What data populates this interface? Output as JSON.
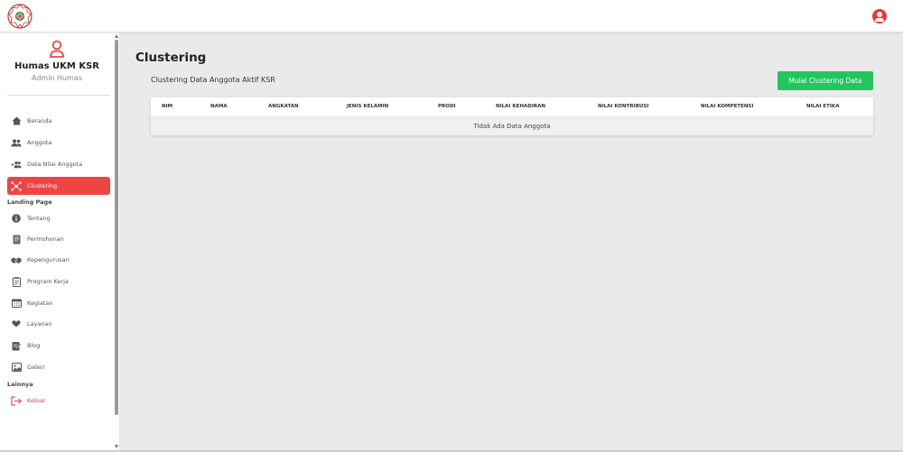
{
  "header": {
    "logo_label": "UKM KSR"
  },
  "sidebar": {
    "profile": {
      "name": "Humas UKM KSR",
      "role": "Admin Humas"
    },
    "items": [
      {
        "label": "Beranda",
        "icon": "home-icon"
      },
      {
        "label": "Anggota",
        "icon": "users-icon"
      },
      {
        "label": "Data Nilai Anggota",
        "icon": "user-plus-icon"
      },
      {
        "label": "Clustering",
        "icon": "cluster-icon",
        "active": true
      }
    ],
    "landing_section": "Landing Page",
    "landing_items": [
      {
        "label": "Tentang",
        "icon": "info-icon"
      },
      {
        "label": "Permohonan",
        "icon": "document-icon"
      },
      {
        "label": "Kepengurusan",
        "icon": "handshake-icon"
      },
      {
        "label": "Program Kerja",
        "icon": "clipboard-icon"
      },
      {
        "label": "Kegiatan",
        "icon": "calendar-icon"
      },
      {
        "label": "Layanan",
        "icon": "heart-hand-icon"
      },
      {
        "label": "Blog",
        "icon": "edit-icon"
      },
      {
        "label": "Galeri",
        "icon": "image-icon"
      }
    ],
    "other_section": "Lainnya",
    "logout_label": "Keluar"
  },
  "main": {
    "title": "Clustering",
    "subtitle": "Clustering Data Anggota Aktif KSR",
    "action_button": "Mulai Clustering Data",
    "table": {
      "columns": [
        "NIM",
        "NAMA",
        "ANGKATAN",
        "JENIS KELAMIN",
        "PRODI",
        "NILAI KEHADIRAN",
        "NILAI KONTRIBUSI",
        "NILAI KOMPETENSI",
        "NILAI ETIKA"
      ],
      "empty_message": "Tidak Ada Data Anggota"
    }
  },
  "colors": {
    "accent_red": "#ef4444",
    "action_green": "#22c55e"
  }
}
